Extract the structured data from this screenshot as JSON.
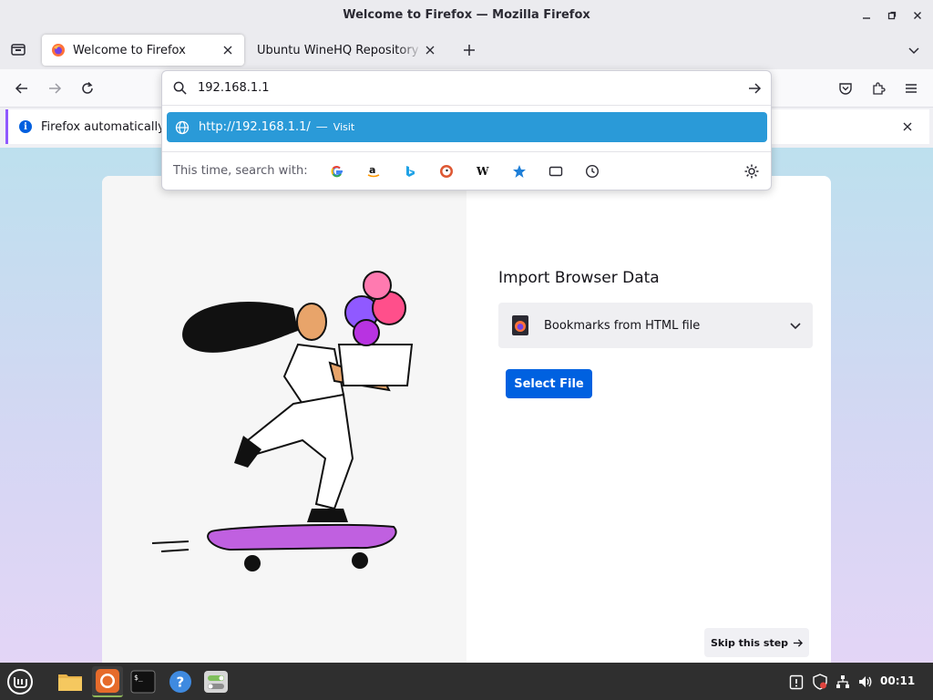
{
  "window": {
    "title": "Welcome to Firefox — Mozilla Firefox"
  },
  "tabs": [
    {
      "label": "Welcome to Firefox",
      "active": true
    },
    {
      "label": "Ubuntu WineHQ Repository - W",
      "active": false
    }
  ],
  "notification": {
    "text": "Firefox automatically"
  },
  "urlbar": {
    "value": "192.168.1.1",
    "suggestion": {
      "url": "http://192.168.1.1/",
      "separator": "—",
      "action": "Visit"
    },
    "search_with_label": "This time, search with:",
    "engines": [
      "google",
      "amazon",
      "bing",
      "duckduckgo",
      "wikipedia",
      "bookmarks",
      "tabs",
      "history"
    ]
  },
  "page": {
    "heading": "Import Browser Data",
    "import_source": "Bookmarks from HTML file",
    "select_file_label": "Select File",
    "skip_label": "Skip this step"
  },
  "taskbar": {
    "clock": "00:11"
  },
  "colors": {
    "accent": "#0061e0",
    "highlight": "#2a9ad8",
    "purple": "#9059ff"
  }
}
